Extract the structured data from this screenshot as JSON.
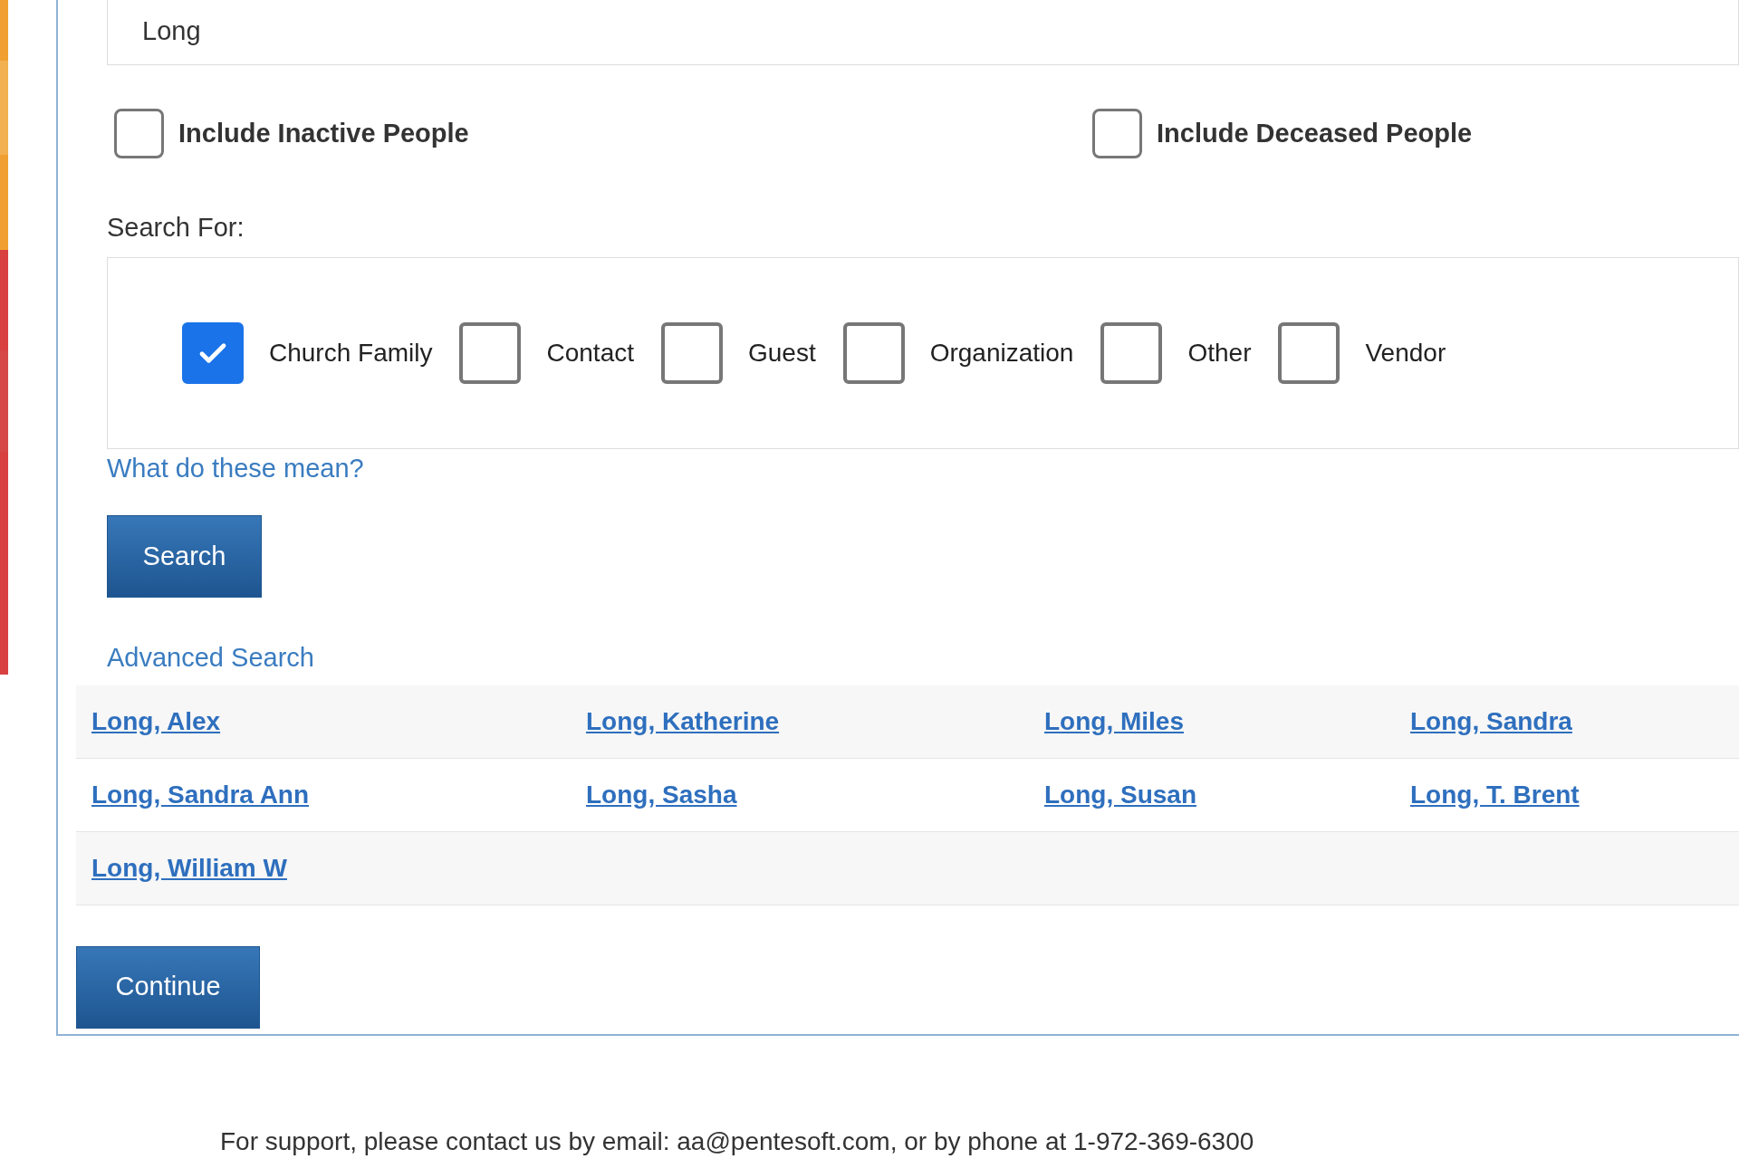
{
  "name_field": {
    "value": "Long"
  },
  "options": [
    {
      "label": "Include Inactive People",
      "checked": false
    },
    {
      "label": "Include Deceased People",
      "checked": false
    }
  ],
  "search_for": {
    "label": "Search For:",
    "types": [
      {
        "label": "Church Family",
        "checked": true
      },
      {
        "label": "Contact",
        "checked": false
      },
      {
        "label": "Guest",
        "checked": false
      },
      {
        "label": "Organization",
        "checked": false
      },
      {
        "label": "Other",
        "checked": false
      },
      {
        "label": "Vendor",
        "checked": false
      }
    ]
  },
  "help_link": "What do these mean?",
  "search_button": "Search",
  "advanced_link": "Advanced Search",
  "results": [
    [
      "Long, Alex",
      "Long, Katherine",
      "Long, Miles",
      "Long, Sandra"
    ],
    [
      "Long, Sandra Ann",
      "Long, Sasha",
      "Long, Susan",
      "Long, T. Brent"
    ],
    [
      "Long, William W"
    ]
  ],
  "continue_button": "Continue",
  "footer": "For support, please contact us by email: aa@pentesoft.com, or by phone at 1-972-369-6300"
}
